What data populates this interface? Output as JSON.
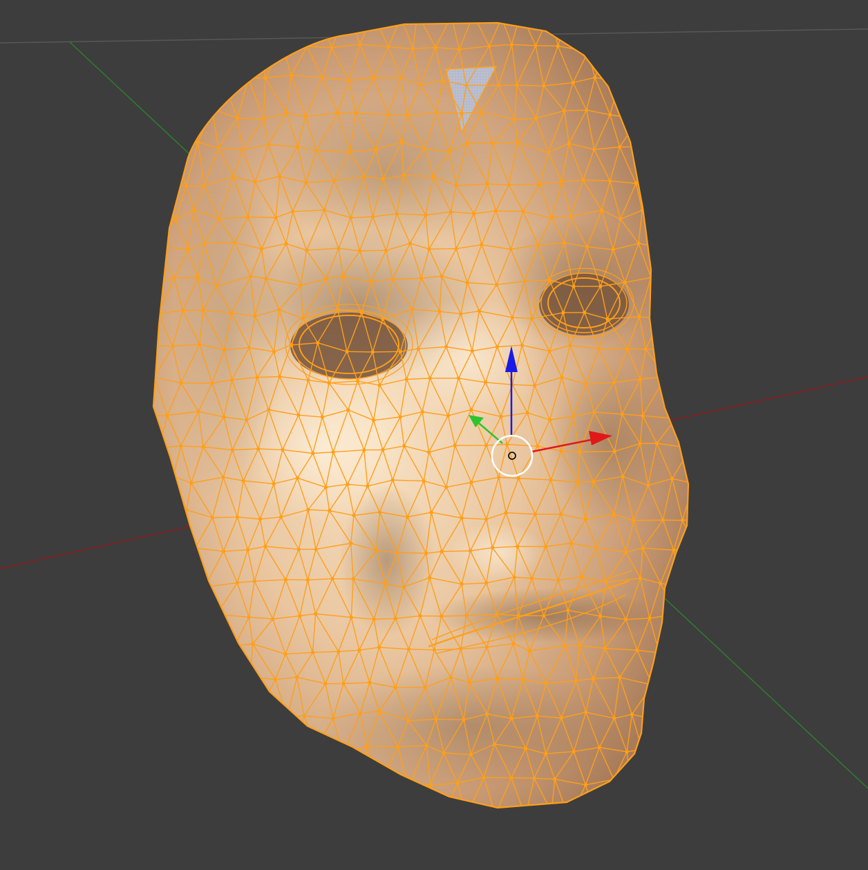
{
  "viewport": {
    "background": "#3d3d3d",
    "mode": "edit-mode-wireframe-overlay"
  },
  "colors": {
    "axis_x": "#8b1c1c",
    "axis_y": "#2e7d2e",
    "horizon": "#585858",
    "skin_light": "#f6dcbc",
    "skin_mid": "#d9b08a",
    "skin_shadow": "#8a6a4e",
    "wire": "#ff9f1a",
    "selected_face": "#b8bccc",
    "gizmo_x": "#e01818",
    "gizmo_y": "#2ec42e",
    "gizmo_z": "#1a1ae6",
    "pivot_ring": "#ffffff"
  },
  "object": {
    "name_visible": false,
    "type": "mesh",
    "shape": "face-mask"
  },
  "gizmo": {
    "type": "translate-manipulator",
    "axes": [
      "x-arrow-icon",
      "y-arrow-icon",
      "z-arrow-icon"
    ],
    "pivot": "pivot-circle-icon"
  }
}
